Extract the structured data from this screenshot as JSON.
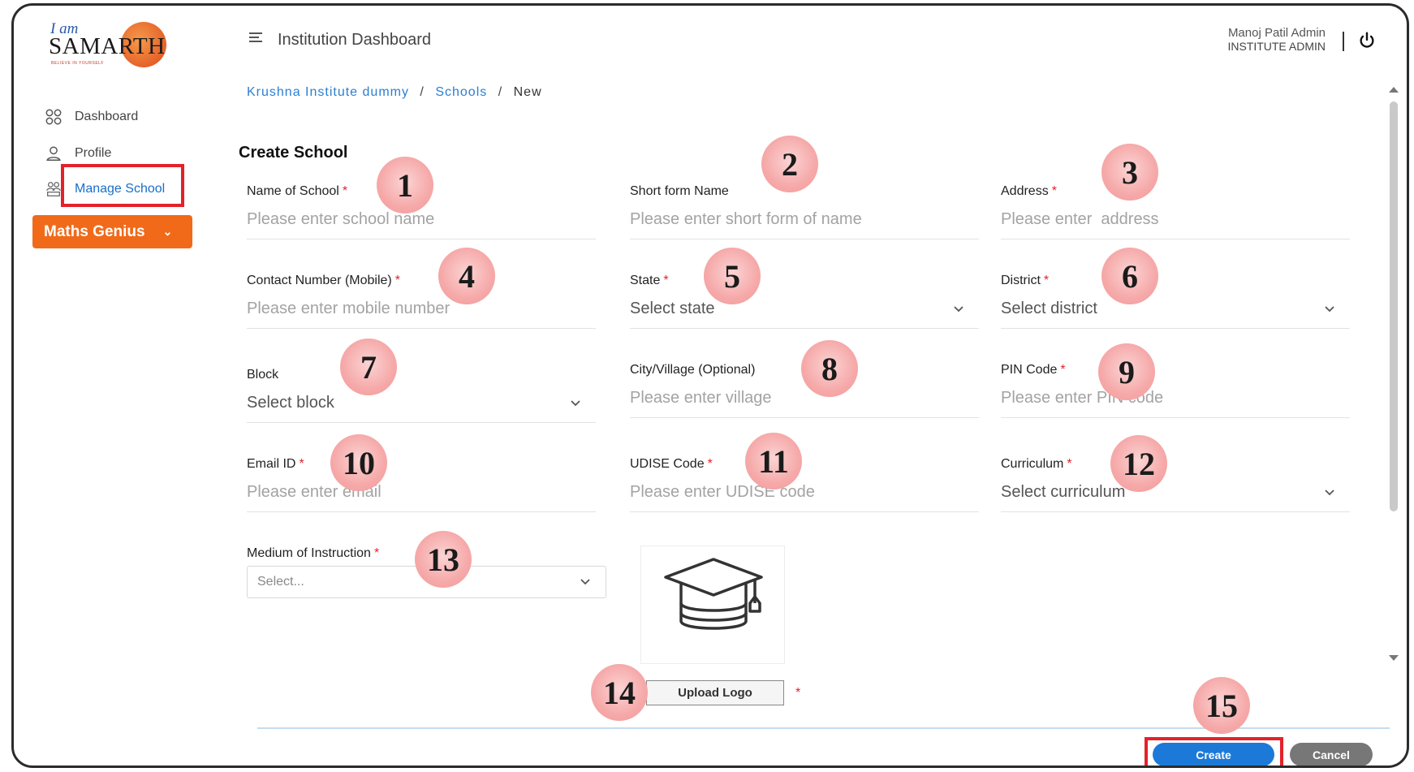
{
  "header": {
    "logo_iam": "I am",
    "logo_brand": "SAMARTH",
    "logo_tagline": "BELIEVE IN YOURSELF",
    "app_title": "Institution Dashboard",
    "user_name": "Manoj Patil Admin",
    "user_role": "INSTITUTE ADMIN"
  },
  "sidebar": {
    "items": [
      {
        "label": "Dashboard",
        "icon": "grid-icon"
      },
      {
        "label": "Profile",
        "icon": "user-icon"
      },
      {
        "label": "Manage School",
        "icon": "school-users-icon",
        "active": true
      }
    ],
    "program_button": "Maths Genius"
  },
  "breadcrumb": {
    "institute": "Krushna Institute dummy",
    "section": "Schools",
    "current": "New",
    "separator": "/"
  },
  "page_title": "Create School",
  "form": {
    "school_name": {
      "label": "Name of School",
      "placeholder": "Please enter school name",
      "required": true
    },
    "short_name": {
      "label": "Short form Name",
      "placeholder": "Please enter short form of name",
      "required": false
    },
    "address": {
      "label": "Address",
      "placeholder": "Please enter  address",
      "required": true
    },
    "contact": {
      "label": "Contact Number (Mobile)",
      "placeholder": "Please enter mobile number",
      "required": true
    },
    "state": {
      "label": "State",
      "value": "Select state",
      "required": true
    },
    "district": {
      "label": "District",
      "value": "Select district",
      "required": true
    },
    "block": {
      "label": "Block",
      "value": "Select block",
      "required": false
    },
    "city": {
      "label": "City/Village (Optional)",
      "placeholder": "Please enter village",
      "required": false
    },
    "pin": {
      "label": "PIN Code",
      "placeholder": "Please enter PIN code",
      "required": true
    },
    "email": {
      "label": "Email ID",
      "placeholder": "Please enter email",
      "required": true
    },
    "udise": {
      "label": "UDISE Code",
      "placeholder": "Please enter UDISE code",
      "required": true
    },
    "curriculum": {
      "label": "Curriculum",
      "value": "Select curriculum",
      "required": true
    },
    "medium": {
      "label": "Medium of Instruction",
      "value": "Select...",
      "required": true
    },
    "required_mark": "*"
  },
  "logo_upload": {
    "button": "Upload Logo",
    "icon": "graduation-cap-icon"
  },
  "actions": {
    "create": "Create",
    "cancel": "Cancel"
  },
  "callouts": [
    "1",
    "2",
    "3",
    "4",
    "5",
    "6",
    "7",
    "8",
    "9",
    "10",
    "11",
    "12",
    "13",
    "14",
    "15"
  ],
  "colors": {
    "accent_blue": "#1c79d8",
    "brand_orange": "#f06a1a",
    "highlight_red": "#e3222a",
    "callout_pink": "#f6a9a9"
  }
}
